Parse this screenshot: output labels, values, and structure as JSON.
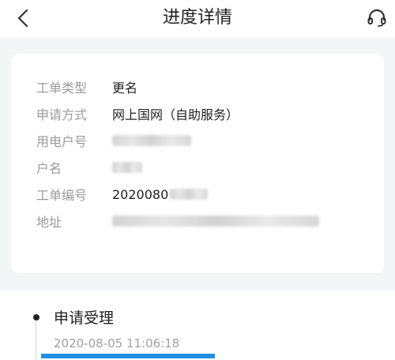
{
  "header": {
    "title": "进度详情",
    "back_icon": "chevron-left-icon",
    "service_icon": "headset-icon"
  },
  "details": {
    "rows": [
      {
        "label": "工单类型",
        "value": "更名"
      },
      {
        "label": "申请方式",
        "value": "网上国网（自助服务）"
      },
      {
        "label": "用电户号",
        "value": ""
      },
      {
        "label": "户名",
        "value": ""
      },
      {
        "label": "工单编号",
        "value": "2020080"
      },
      {
        "label": "地址",
        "value": ""
      }
    ]
  },
  "timeline": {
    "steps": [
      {
        "title": "申请受理",
        "time": "2020-08-05 11:06:18"
      }
    ]
  },
  "colors": {
    "accent": "#1f8fe0",
    "label": "#9a9a9a",
    "text": "#222222",
    "background": "#f4f5f7"
  }
}
